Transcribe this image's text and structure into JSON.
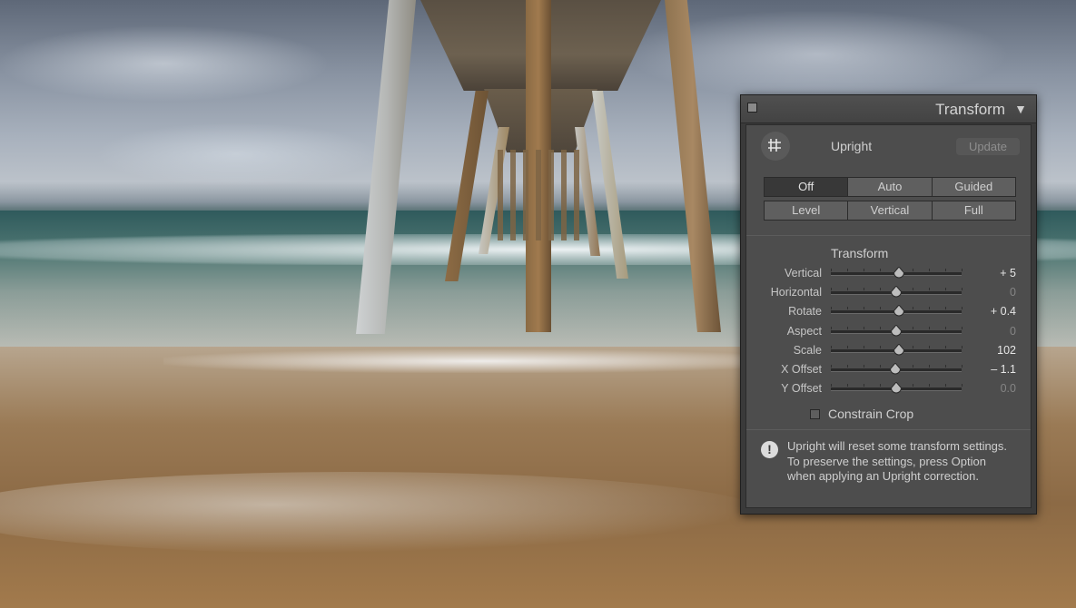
{
  "panel": {
    "title": "Transform",
    "collapse_glyph": "▼",
    "upright": {
      "label": "Upright",
      "update_label": "Update",
      "tool_icon": "crop-grid-icon",
      "buttons_row1": [
        "Off",
        "Auto",
        "Guided"
      ],
      "buttons_row2": [
        "Level",
        "Vertical",
        "Full"
      ],
      "selected": "Off"
    },
    "transform": {
      "heading": "Transform",
      "sliders": [
        {
          "label": "Vertical",
          "value": "+ 5",
          "position": 0.52,
          "active": true
        },
        {
          "label": "Horizontal",
          "value": "0",
          "position": 0.5,
          "active": false
        },
        {
          "label": "Rotate",
          "value": "+ 0.4",
          "position": 0.52,
          "active": true
        },
        {
          "label": "Aspect",
          "value": "0",
          "position": 0.5,
          "active": false
        },
        {
          "label": "Scale",
          "value": "102",
          "position": 0.52,
          "active": true
        },
        {
          "label": "X Offset",
          "value": "– 1.1",
          "position": 0.49,
          "active": true
        },
        {
          "label": "Y Offset",
          "value": "0.0",
          "position": 0.5,
          "active": false
        }
      ]
    },
    "constrain_crop": {
      "label": "Constrain Crop",
      "checked": false
    },
    "notice": {
      "icon": "exclamation-icon",
      "line1": "Upright will reset some transform settings.",
      "line2": "To preserve the settings, press Option",
      "line3": "when applying an Upright correction."
    }
  },
  "colors": {
    "panel_bg": "#4f4f4f",
    "panel_border": "#2a2a2a",
    "text_light": "#d8d8d8",
    "text_dim": "#8c8c8c",
    "button_bg": "#5e5e5e",
    "button_selected": "#3b3b3b"
  }
}
